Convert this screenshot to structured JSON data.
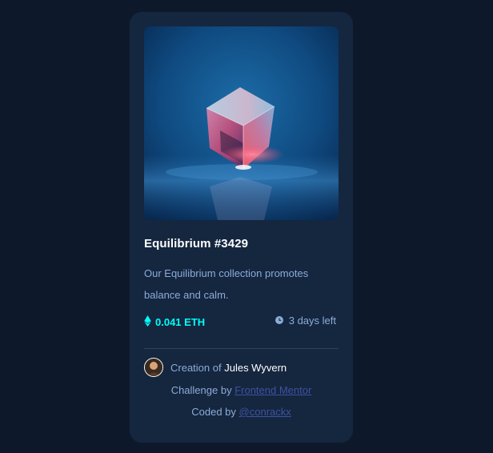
{
  "card": {
    "title": "Equilibrium #3429",
    "description": "Our Equilibrium collection promotes balance and calm.",
    "price": "0.041 ETH",
    "time_left": "3 days left",
    "creator_prefix": "Creation of",
    "creator_name": "Jules Wyvern"
  },
  "attribution": {
    "challenge_prefix": "Challenge by",
    "challenge_link": "Frontend Mentor",
    "coded_prefix": "Coded by",
    "coded_link": "@conrackx"
  },
  "colors": {
    "page_bg": "#0d192b",
    "card_bg": "#15263f",
    "accent_cyan": "#00fff8",
    "soft_blue": "#8bacd9",
    "link_blue": "#3e52a3"
  },
  "icons": {
    "price": "ethereum-icon",
    "time": "clock-icon"
  }
}
